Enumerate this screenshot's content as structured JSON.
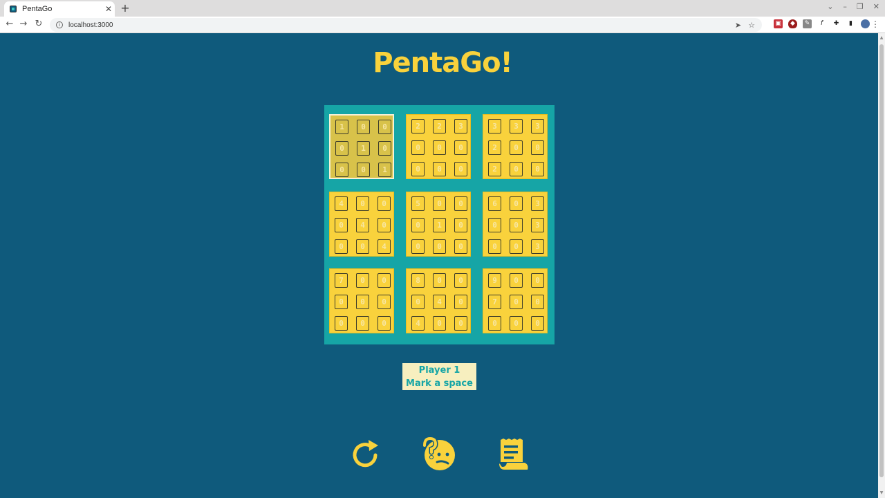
{
  "browser": {
    "tab_title": "PentaGo",
    "tab_close": "✕",
    "new_tab": "+",
    "url": "localhost:3000",
    "window_controls": [
      "⌄",
      "–",
      "❐",
      "✕"
    ]
  },
  "app": {
    "logo": "PentaGo!",
    "colors": {
      "background": "#0f5a7c",
      "board": "#16a5a6",
      "tile": "#f9d23c",
      "accent": "#f9d23c"
    }
  },
  "board": {
    "selected_quadrant": 0,
    "quadrants": [
      [
        [
          "1",
          "0",
          "0"
        ],
        [
          "0",
          "1",
          "0"
        ],
        [
          "0",
          "0",
          "1"
        ]
      ],
      [
        [
          "2",
          "2",
          "3"
        ],
        [
          "0",
          "0",
          "0"
        ],
        [
          "0",
          "0",
          "0"
        ]
      ],
      [
        [
          "3",
          "3",
          "3"
        ],
        [
          "2",
          "0",
          "0"
        ],
        [
          "2",
          "0",
          "0"
        ]
      ],
      [
        [
          "4",
          "0",
          "0"
        ],
        [
          "0",
          "4",
          "0"
        ],
        [
          "0",
          "0",
          "4"
        ]
      ],
      [
        [
          "5",
          "0",
          "0"
        ],
        [
          "0",
          "1",
          "0"
        ],
        [
          "0",
          "0",
          "0"
        ]
      ],
      [
        [
          "6",
          "0",
          "3"
        ],
        [
          "0",
          "0",
          "3"
        ],
        [
          "0",
          "0",
          "3"
        ]
      ],
      [
        [
          "7",
          "0",
          "0"
        ],
        [
          "0",
          "0",
          "0"
        ],
        [
          "0",
          "0",
          "0"
        ]
      ],
      [
        [
          "8",
          "0",
          "0"
        ],
        [
          "0",
          "4",
          "0"
        ],
        [
          "4",
          "0",
          "0"
        ]
      ],
      [
        [
          "9",
          "0",
          "0"
        ],
        [
          "7",
          "0",
          "0"
        ],
        [
          "0",
          "0",
          "0"
        ]
      ]
    ]
  },
  "status": {
    "player": "Player 1",
    "instruction": "Mark a space"
  },
  "controls": [
    {
      "name": "restart",
      "icon": "restart-icon"
    },
    {
      "name": "help",
      "icon": "thinking-face-icon"
    },
    {
      "name": "rules",
      "icon": "scroll-icon"
    }
  ]
}
